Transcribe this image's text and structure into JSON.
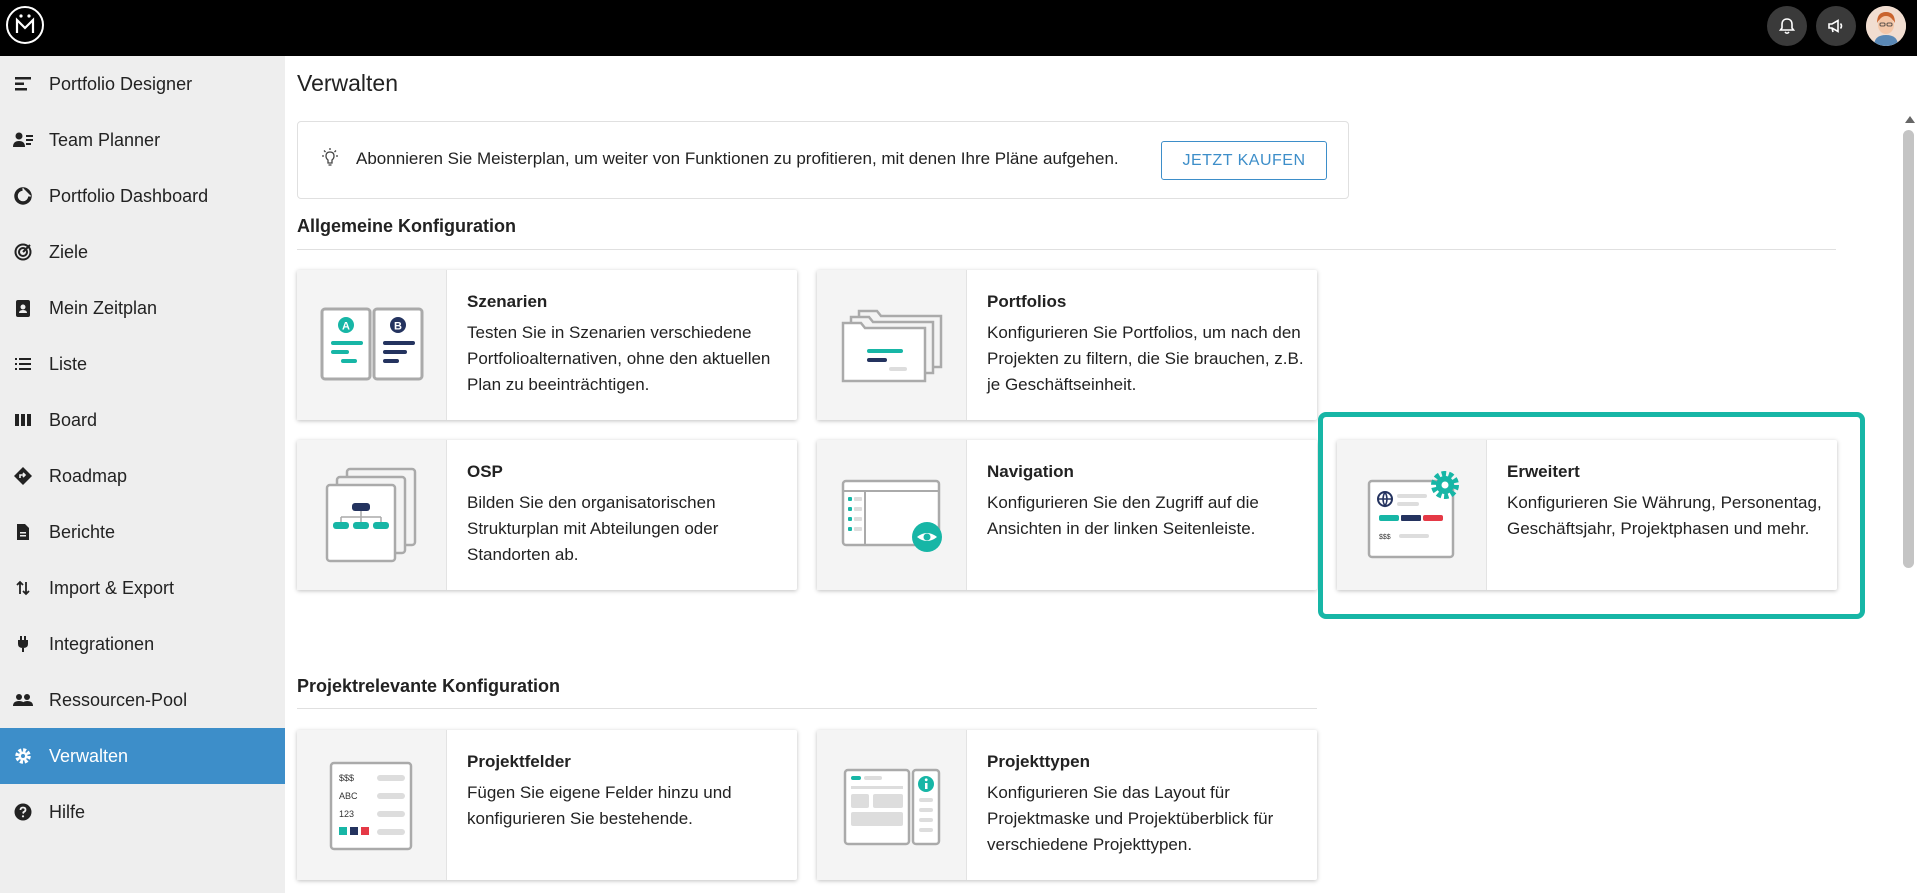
{
  "app": {
    "logo": "Meisterplan logo"
  },
  "topbar": {
    "notifications_icon": "bell-icon",
    "announcements_icon": "megaphone-icon",
    "avatar_icon": "user-avatar"
  },
  "sidebar": {
    "items": [
      {
        "label": "Portfolio Designer",
        "icon": "portfolio-designer-icon"
      },
      {
        "label": "Team Planner",
        "icon": "team-planner-icon"
      },
      {
        "label": "Portfolio Dashboard",
        "icon": "dashboard-icon"
      },
      {
        "label": "Ziele",
        "icon": "target-icon"
      },
      {
        "label": "Mein Zeitplan",
        "icon": "schedule-icon"
      },
      {
        "label": "Liste",
        "icon": "list-icon"
      },
      {
        "label": "Board",
        "icon": "board-icon"
      },
      {
        "label": "Roadmap",
        "icon": "roadmap-icon"
      },
      {
        "label": "Berichte",
        "icon": "report-icon"
      },
      {
        "label": "Import & Export",
        "icon": "import-export-icon"
      },
      {
        "label": "Integrationen",
        "icon": "plug-icon"
      },
      {
        "label": "Ressourcen-Pool",
        "icon": "people-icon"
      },
      {
        "label": "Verwalten",
        "icon": "gear-icon",
        "active": true
      },
      {
        "label": "Hilfe",
        "icon": "help-icon"
      }
    ]
  },
  "main": {
    "title": "Verwalten",
    "banner": {
      "text": "Abonnieren Sie Meisterplan, um weiter von Funktionen zu profitieren, mit denen Ihre Pläne aufgehen.",
      "button": "JETZT KAUFEN"
    },
    "sections": [
      {
        "title": "Allgemeine Konfiguration",
        "cards": [
          {
            "title": "Szenarien",
            "desc": "Testen Sie in Szenarien verschiedene Portfolioalternativen, ohne den aktuellen Plan zu beeinträchtigen.",
            "badge_a": "A",
            "badge_b": "B"
          },
          {
            "title": "Portfolios",
            "desc": "Konfigurieren Sie Portfolios, um nach den Projekten zu filtern, die Sie brauchen, z.B. je Geschäftseinheit."
          },
          {
            "title": "OSP",
            "desc": "Bilden Sie den organisatorischen Strukturplan mit Abteilungen oder Standorten ab."
          },
          {
            "title": "Navigation",
            "desc": "Konfigurieren Sie den Zugriff auf die Ansichten in der linken Seitenleiste."
          },
          {
            "title": "Erweitert",
            "desc": "Konfigurieren Sie Währung, Personentag, Geschäftsjahr, Projektphasen und mehr.",
            "currency": "$$$"
          }
        ]
      },
      {
        "title": "Projektrelevante Konfiguration",
        "cards": [
          {
            "title": "Projektfelder",
            "desc": "Fügen Sie eigene Felder hinzu und konfigurieren Sie bestehende.",
            "field_1": "$$$",
            "field_2": "ABC",
            "field_3": "123"
          },
          {
            "title": "Projekttypen",
            "desc": "Konfigurieren Sie das Layout für Projektmaske und Projektüberblick für verschiedene Projekttypen."
          }
        ]
      }
    ]
  },
  "colors": {
    "accent_teal": "#17b6a6",
    "navy": "#24335f",
    "red": "#e53946",
    "active_blue": "#3d8ec9"
  }
}
